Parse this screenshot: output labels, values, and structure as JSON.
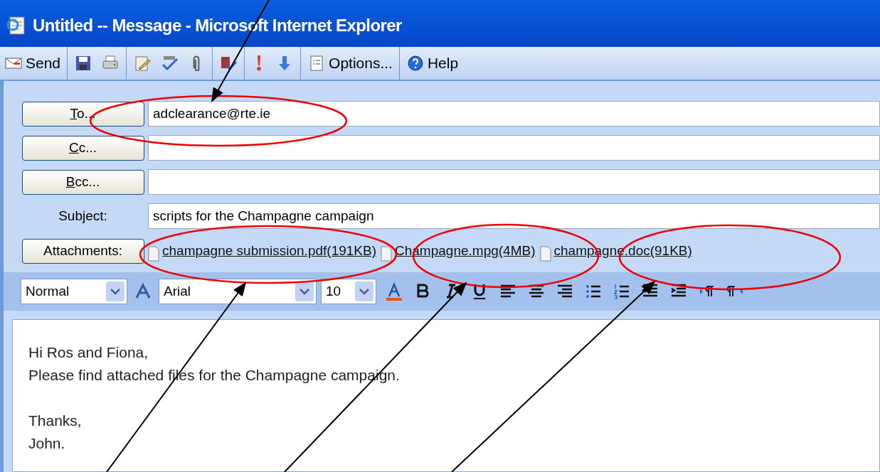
{
  "window": {
    "title": "Untitled -- Message - Microsoft Internet Explorer"
  },
  "toolbar": [
    {
      "kind": "send",
      "label": "Send"
    },
    {
      "kind": "save"
    },
    {
      "kind": "print"
    },
    {
      "kind": "edit"
    },
    {
      "kind": "spell"
    },
    {
      "kind": "attach"
    },
    {
      "kind": "names"
    },
    {
      "kind": "high"
    },
    {
      "kind": "low"
    },
    {
      "kind": "options",
      "label": "Options..."
    },
    {
      "kind": "help",
      "label": "Help"
    }
  ],
  "fields": [
    {
      "button": "To...",
      "value": "adclearance@rte.ie"
    },
    {
      "button": "Cc..."
    },
    {
      "button": "Bcc..."
    },
    {
      "label": "Subject:",
      "value": "scripts for the Champagne campaign"
    }
  ],
  "attachments": {
    "button": "Attachments:",
    "files": [
      "champagne submission.pdf(191KB)",
      "Champagne.mpg(4MB)",
      "champagne.doc(91KB)"
    ]
  },
  "format": {
    "style": "Normal",
    "font": "Arial",
    "size": "10",
    "tools": [
      {
        "kind": "fontcolor"
      },
      {
        "kind": "bold"
      },
      {
        "kind": "italic"
      },
      {
        "kind": "underline"
      },
      {
        "kind": "left"
      },
      {
        "kind": "center"
      },
      {
        "kind": "right"
      },
      {
        "kind": "bullets"
      },
      {
        "kind": "numbers"
      },
      {
        "kind": "outdent"
      },
      {
        "kind": "indent"
      },
      {
        "kind": "ltr"
      },
      {
        "kind": "rtl"
      }
    ]
  },
  "body": [
    [
      "Hi Ros and Fiona,",
      "Please find attached files for the Champagne campaign."
    ],
    [
      "Thanks,",
      "John."
    ]
  ]
}
